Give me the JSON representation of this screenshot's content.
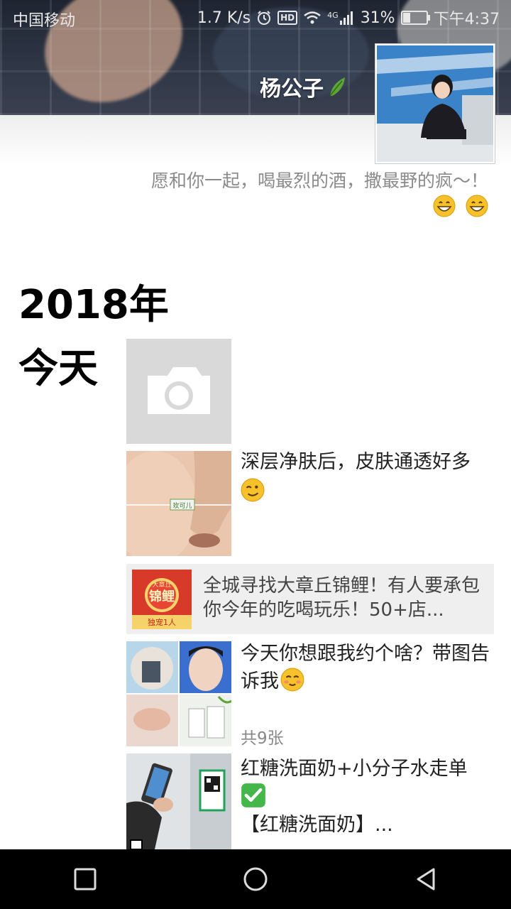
{
  "status_bar": {
    "carrier": "中国移动",
    "speed": "1.7 K/s",
    "hd_badge": "HD",
    "network": "4G",
    "battery": "31%",
    "battery_level": 0.31,
    "time": "下午4:37"
  },
  "profile": {
    "name": "杨公子",
    "signature": "愿和你一起，喝最烈的酒，撒最野的疯～！",
    "signature_emojis": [
      "grinning-emoji",
      "grinning-emoji"
    ]
  },
  "timeline": {
    "year": "2018年",
    "day_label": "今天",
    "posts": [
      {
        "type": "camera",
        "icon": "camera-icon"
      },
      {
        "type": "photo",
        "text": "深层净肤后，皮肤通透好多",
        "emoji": "winking-emoji",
        "thumb_label": "玫可儿"
      },
      {
        "type": "link",
        "text": "全城寻找大章丘锦鲤！有人要承包你今年的吃喝玩乐！50+店...",
        "thumb_top": "大章丘",
        "thumb_main": "锦鲤",
        "thumb_bottom": "独宠1人"
      },
      {
        "type": "album",
        "text": "今天你想跟我约个啥？带图告诉我",
        "emoji": "blushing-emoji",
        "count": "共9张"
      },
      {
        "type": "photo",
        "text_line1": "红糖洗面奶+小分子水走单",
        "emoji": "check-mark-emoji",
        "text_line2": "【红糖洗面奶】..."
      }
    ]
  },
  "nav": {
    "buttons": [
      "recent-apps",
      "home",
      "back"
    ]
  },
  "colors": {
    "nav_bg": "#000000",
    "link_card_bg": "#efefef",
    "camera_tile_bg": "#d9d9d9",
    "signature": "#8a8a8a"
  }
}
